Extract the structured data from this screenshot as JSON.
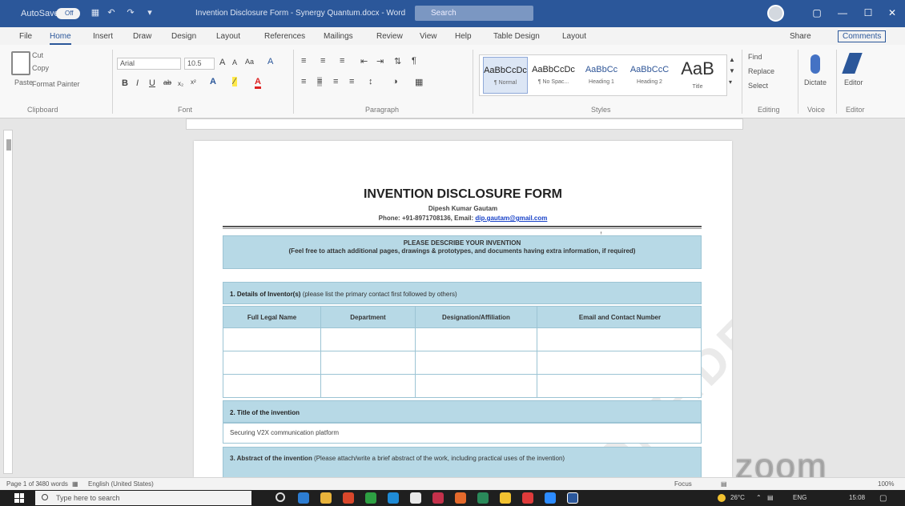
{
  "titlebar": {
    "autosave_label": "AutoSave",
    "autosave_state": "Off",
    "doc_title": "Invention Disclosure Form - Synergy Quantum.docx - Word",
    "search_placeholder": "Search",
    "window_controls": [
      "—",
      "☐",
      "✕"
    ]
  },
  "menu": {
    "items": [
      "File",
      "Home",
      "Insert",
      "Draw",
      "Design",
      "Layout",
      "References",
      "Mailings",
      "Review",
      "View",
      "Help",
      "Table Design",
      "Layout"
    ],
    "active": "Home",
    "share": "Share",
    "comments": "Comments"
  },
  "ribbon": {
    "clipboard": {
      "paste": "Paste",
      "cut": "Cut",
      "copy": "Copy",
      "format_painter": "Format Painter",
      "label": "Clipboard"
    },
    "font": {
      "name": "Arial",
      "size": "10.5",
      "label": "Font"
    },
    "paragraph": {
      "label": "Paragraph"
    },
    "styles": {
      "label": "Styles",
      "items": [
        {
          "sample": "AaBbCcDc",
          "name": "¶ Normal"
        },
        {
          "sample": "AaBbCcDc",
          "name": "¶ No Spac..."
        },
        {
          "sample": "AaBbCc",
          "name": "Heading 1"
        },
        {
          "sample": "AaBbCcC",
          "name": "Heading 2"
        },
        {
          "sample": "AaB",
          "name": "Title"
        }
      ]
    },
    "editing": {
      "find": "Find",
      "replace": "Replace",
      "select": "Select",
      "label": "Editing"
    },
    "voice": {
      "dictate": "Dictate",
      "label": "Voice"
    },
    "editor": {
      "editor": "Editor",
      "label": "Editor"
    }
  },
  "document": {
    "title": "INVENTION DISCLOSURE FORM",
    "author": "Dipesh Kumar Gautam",
    "phone_line": "Phone: +91-8971708136, Email: ",
    "email": "dip.gautam@gmail.com",
    "describe_heading": "PLEASE DESCRIBE YOUR INVENTION",
    "describe_note": "(Feel free to attach additional pages, drawings & prototypes, and documents having extra information, if required)",
    "section1_title": "1. Details of Inventor(s)",
    "section1_note": " (please list the primary contact first followed by others)",
    "table_headers": [
      "Full Legal Name",
      "Department",
      "Designation/Affiliation",
      "Email and Contact Number"
    ],
    "table_rows": 3,
    "section2_title": "2. Title of the invention",
    "section2_value": "Securing V2X communication platform",
    "section3_title": "3. Abstract of the invention",
    "section3_note": " (Please attach/write a brief abstract of the work, including practical uses of the invention)",
    "watermark": "CONFIDENTIAL"
  },
  "statusbar": {
    "page": "Page 1 of 3",
    "words": "480 words",
    "language": "English (United States)",
    "focus": "Focus",
    "zoom": "100%"
  },
  "overlay": {
    "zoom_logo": "zoom"
  },
  "taskbar": {
    "search_placeholder": "Type here to search",
    "temp": "26°C",
    "lang": "ENG",
    "time": "15:08"
  }
}
